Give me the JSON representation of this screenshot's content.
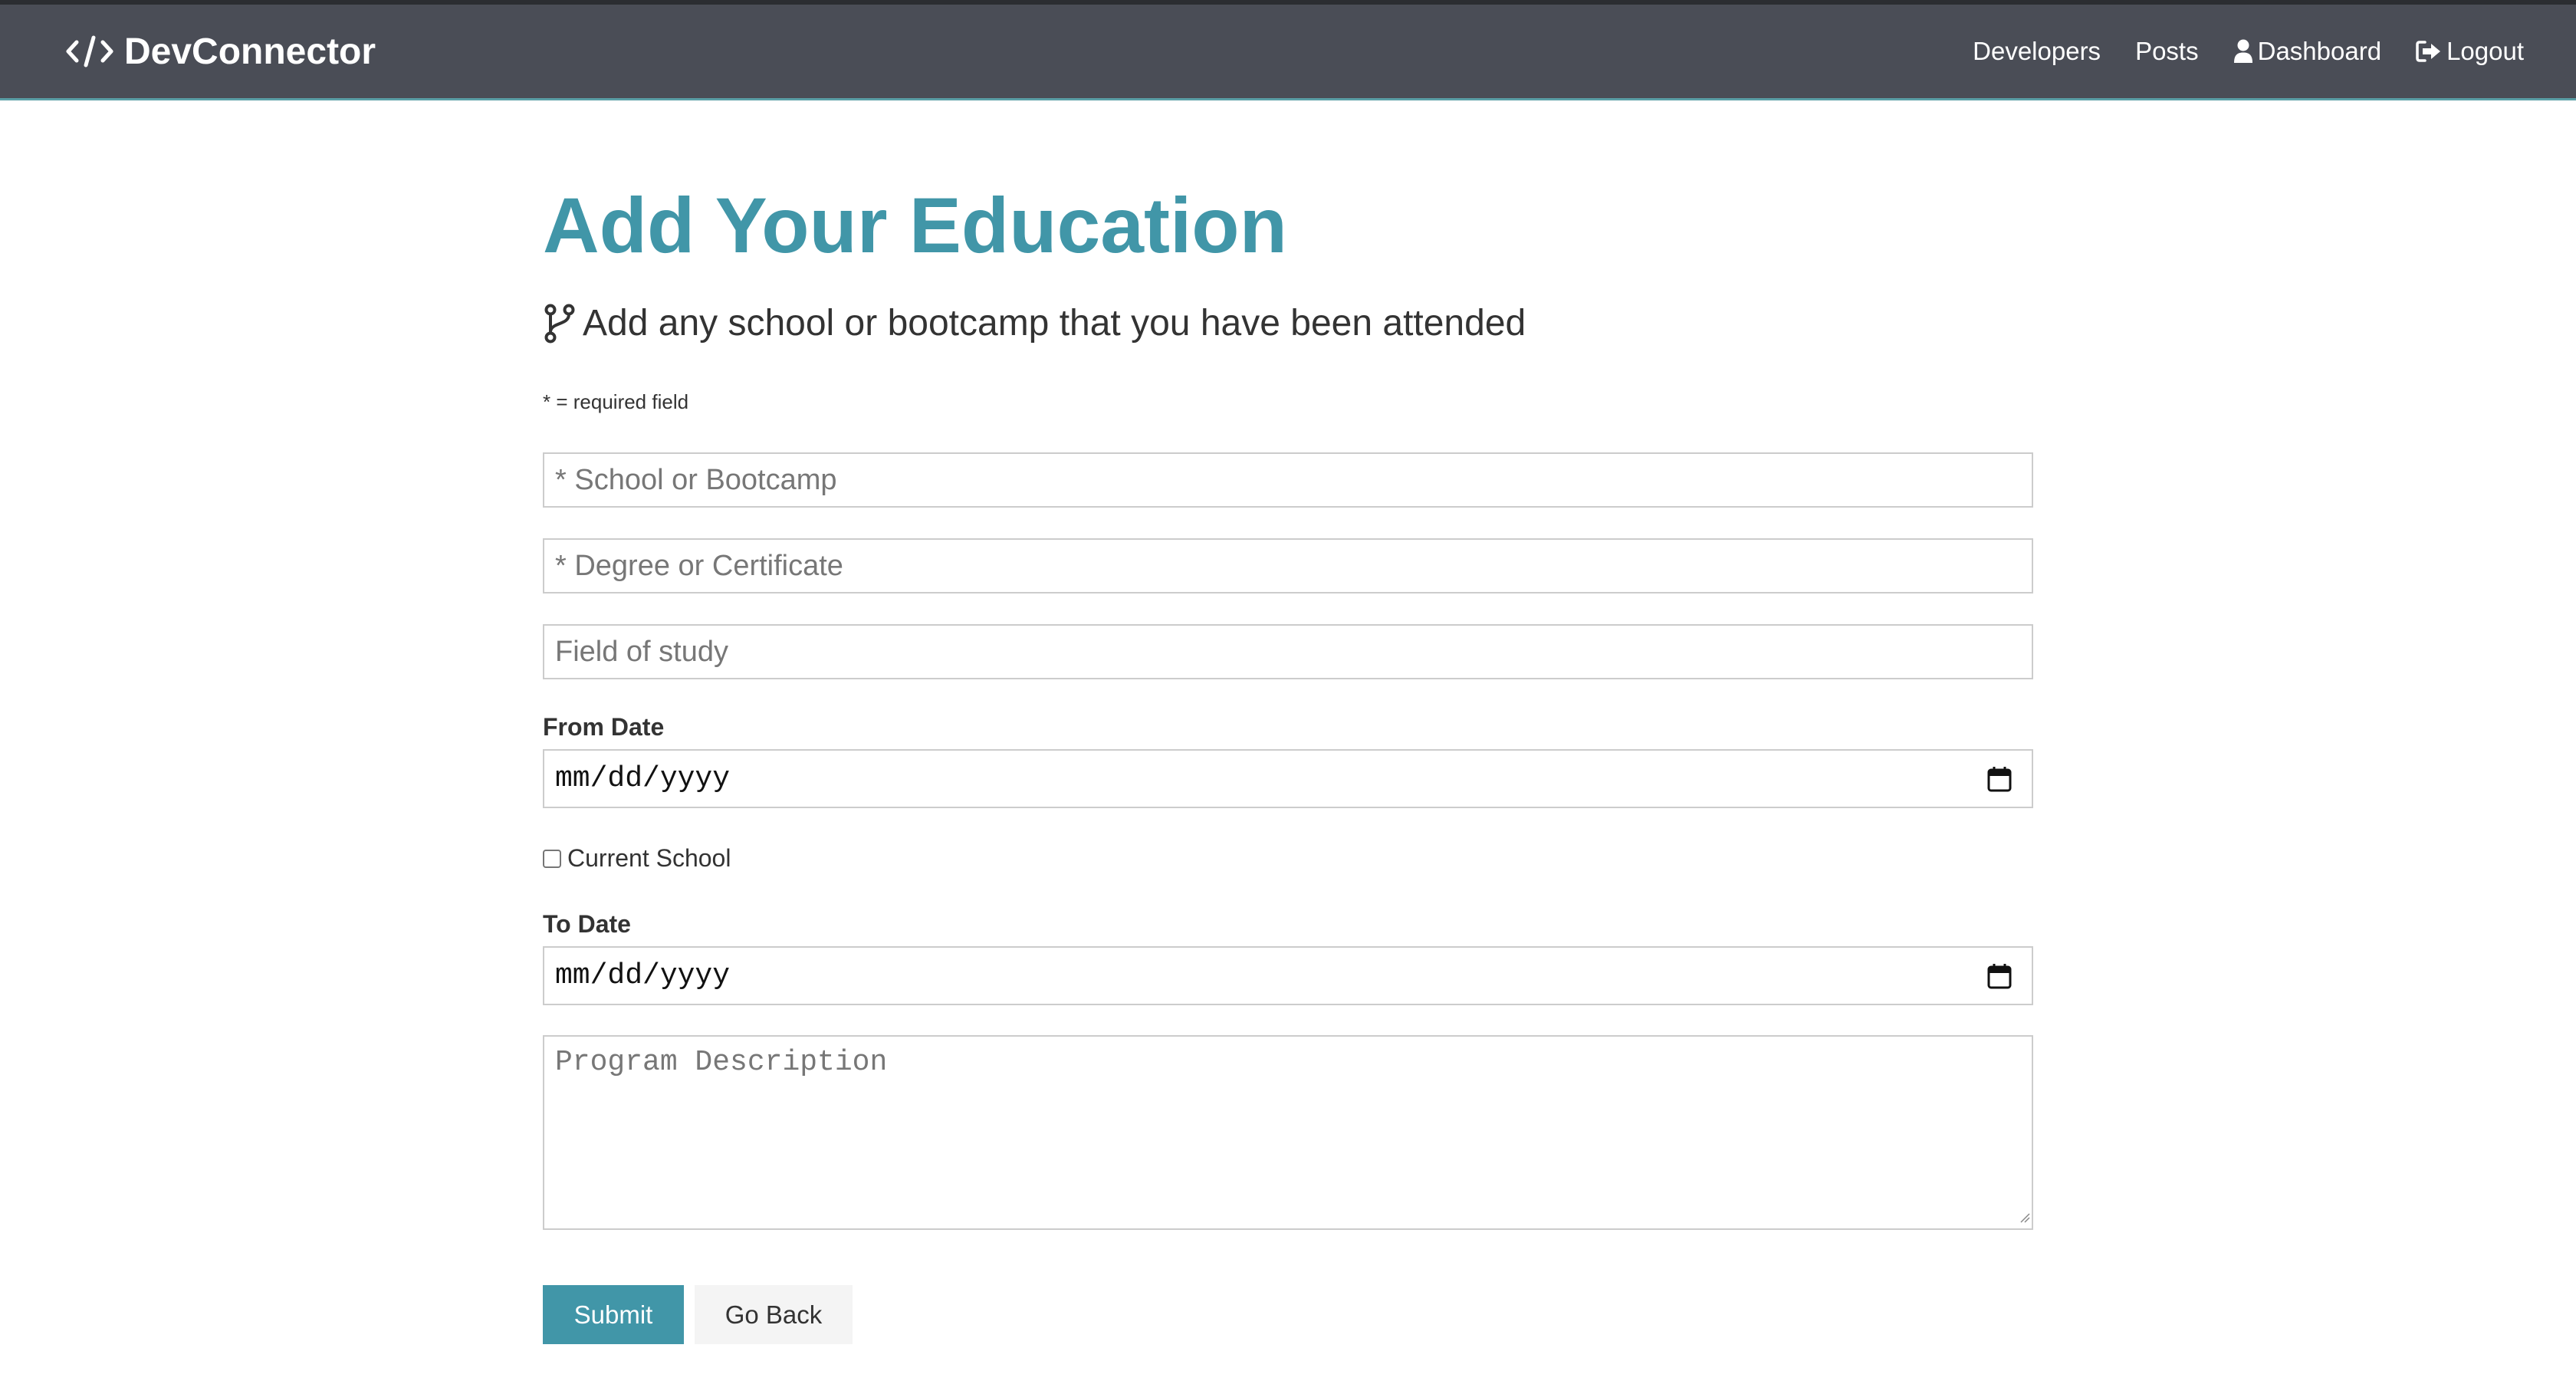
{
  "navbar": {
    "brand": "DevConnector",
    "brand_icon": "code-icon",
    "links": {
      "developers": "Developers",
      "posts": "Posts",
      "dashboard": "Dashboard",
      "logout": "Logout"
    },
    "icons": {
      "dashboard": "user-icon",
      "logout": "sign-out-icon"
    }
  },
  "page": {
    "title": "Add Your Education",
    "lead": "Add any school or bootcamp that you have been attended",
    "lead_icon": "code-branch-icon",
    "required_note": "* = required field"
  },
  "form": {
    "school": {
      "placeholder": "* School or Bootcamp",
      "value": ""
    },
    "degree": {
      "placeholder": "* Degree or Certificate",
      "value": ""
    },
    "field_of_study": {
      "placeholder": "Field of study",
      "value": ""
    },
    "from_date": {
      "label": "From Date",
      "value": "mm/dd/yyyy"
    },
    "current": {
      "label": "Current School",
      "checked": false
    },
    "to_date": {
      "label": "To Date",
      "value": "mm/dd/yyyy"
    },
    "description": {
      "placeholder": "Program Description",
      "value": ""
    },
    "submit_label": "Submit",
    "back_label": "Go Back"
  },
  "colors": {
    "primary": "#4196a8",
    "navbar_bg": "#4a4d56",
    "light_button": "#f4f4f4",
    "text": "#333333"
  }
}
